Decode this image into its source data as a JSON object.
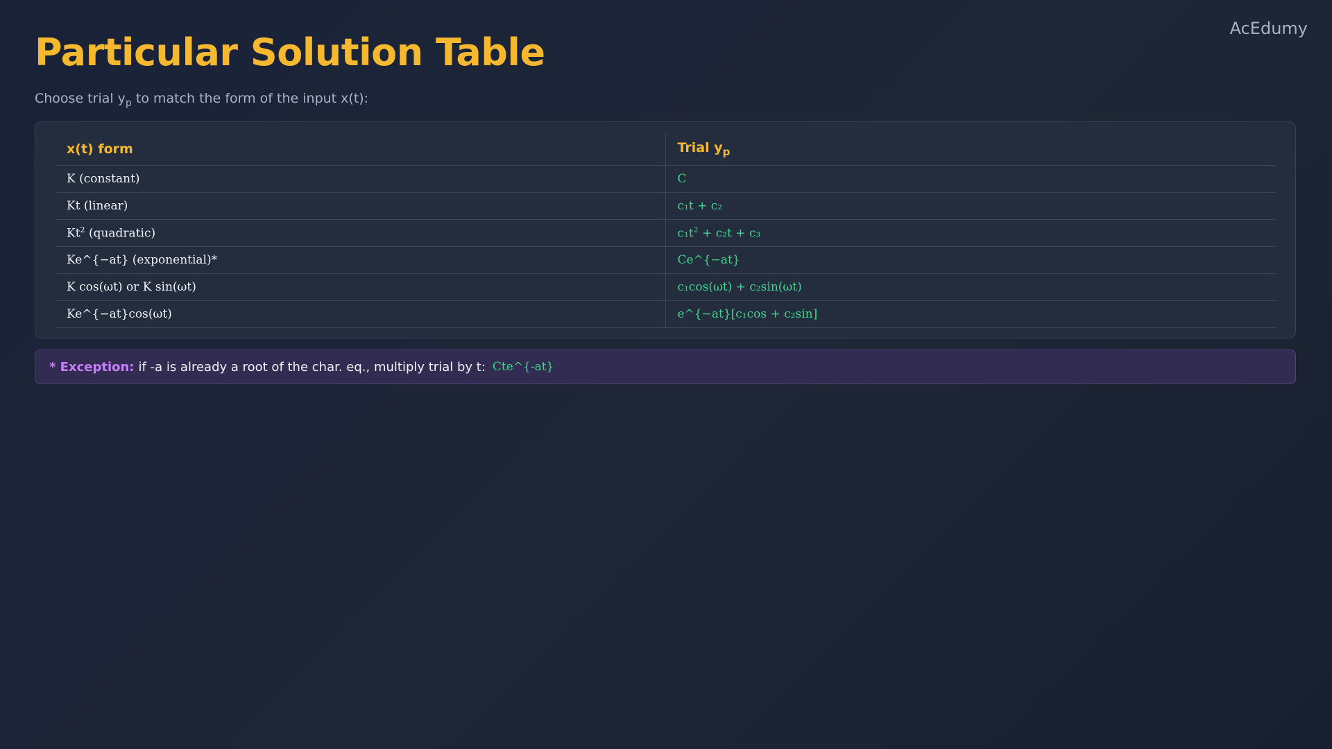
{
  "brand": "AcEdumy",
  "title": "Particular Solution Table",
  "subtitle": {
    "before": "Choose trial y",
    "sub": "p",
    "after": " to match the form of the input x(t):"
  },
  "table": {
    "headers": {
      "col1": "x(t) form",
      "col2_main": "Trial y",
      "col2_sub": "p"
    },
    "rows": [
      {
        "x_main": "K (constant)",
        "trial": "C"
      },
      {
        "x_main": "Kt (linear)",
        "trial": "c₁t + c₂"
      },
      {
        "x_pre": "Kt",
        "x_sup": "2",
        "x_post": " (quadratic)",
        "trial_pre": "c₁t",
        "trial_sup": "2",
        "trial_post": " + c₂t + c₃"
      },
      {
        "x_main": "Ke^{−at} (exponential)*",
        "trial": "Ce^{−at}"
      },
      {
        "x_main": "K cos(ωt) or K sin(ωt)",
        "trial": "c₁cos(ωt) + c₂sin(ωt)"
      },
      {
        "x_main": "Ke^{−at}cos(ωt)",
        "trial": "e^{−at}[c₁cos + c₂sin]"
      }
    ]
  },
  "note": {
    "label": "* Exception:",
    "text": "if -a is already a root of the char. eq., multiply trial by t:",
    "code": "Cte^{-at}"
  },
  "colors": {
    "accent": "#f5b82e",
    "trial": "#3fd68a",
    "exception": "#c77dff"
  }
}
